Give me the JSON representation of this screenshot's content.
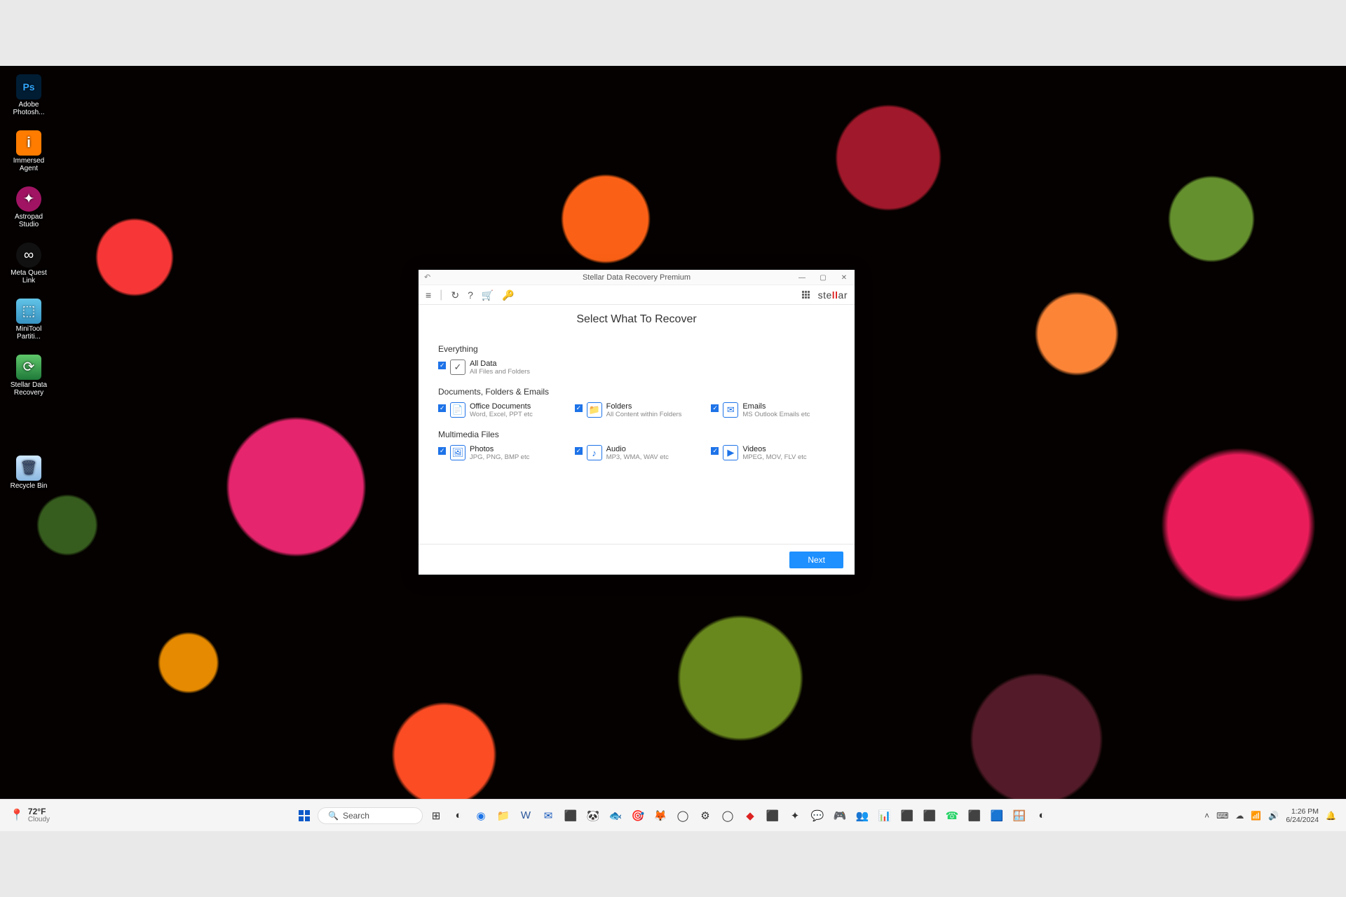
{
  "desktop": {
    "icons": [
      {
        "label": "Adobe\nPhotosh..."
      },
      {
        "label": "Immersed\nAgent"
      },
      {
        "label": "Astropad\nStudio"
      },
      {
        "label": "Meta Quest\nLink"
      },
      {
        "label": "MiniTool\nPartiti..."
      },
      {
        "label": "Stellar Data\nRecovery"
      }
    ],
    "recycle": "Recycle Bin"
  },
  "app": {
    "title": "Stellar Data Recovery Premium",
    "brand_prefix": "ste",
    "brand_accent": "ll",
    "brand_suffix": "ar",
    "heading": "Select What To Recover",
    "sections": {
      "everything": {
        "label": "Everything",
        "item": {
          "title": "All Data",
          "sub": "All Files and Folders"
        }
      },
      "docs": {
        "label": "Documents, Folders & Emails",
        "items": [
          {
            "title": "Office Documents",
            "sub": "Word, Excel, PPT etc",
            "icon": "📄"
          },
          {
            "title": "Folders",
            "sub": "All Content within Folders",
            "icon": "📁"
          },
          {
            "title": "Emails",
            "sub": "MS Outlook Emails etc",
            "icon": "✉"
          }
        ]
      },
      "media": {
        "label": "Multimedia Files",
        "items": [
          {
            "title": "Photos",
            "sub": "JPG, PNG, BMP etc",
            "icon": "🖼"
          },
          {
            "title": "Audio",
            "sub": "MP3, WMA, WAV etc",
            "icon": "♪"
          },
          {
            "title": "Videos",
            "sub": "MPEG, MOV, FLV etc",
            "icon": "▶"
          }
        ]
      }
    },
    "next_label": "Next"
  },
  "taskbar": {
    "weather": {
      "temp": "72°F",
      "cond": "Cloudy"
    },
    "search_placeholder": "Search",
    "time": "1:26 PM",
    "date": "6/24/2024"
  }
}
